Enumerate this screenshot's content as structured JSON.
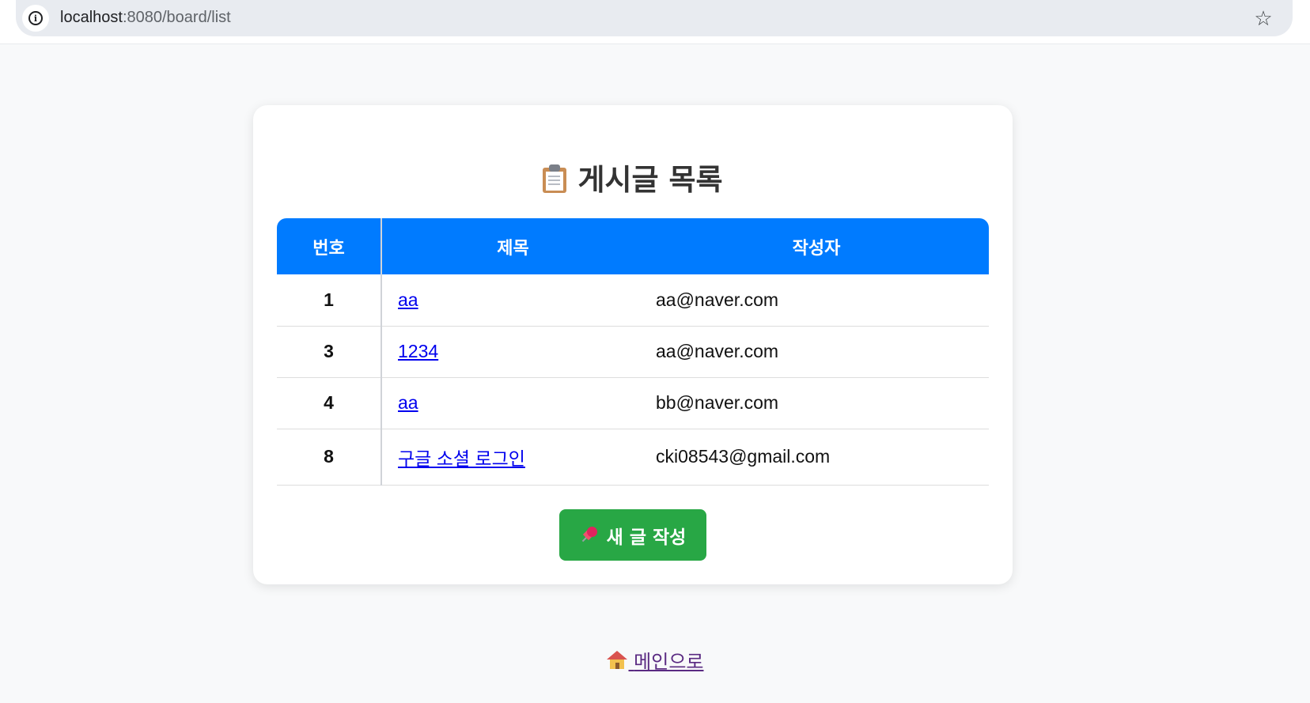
{
  "browser": {
    "url_host": "localhost",
    "url_path": ":8080/board/list"
  },
  "page": {
    "title": "게시글 목록",
    "title_icon": "clipboard-icon"
  },
  "table": {
    "headers": {
      "no": "번호",
      "title": "제목",
      "author": "작성자"
    },
    "rows": [
      {
        "no": "1",
        "title": "aa",
        "author": "aa@naver.com"
      },
      {
        "no": "3",
        "title": "1234",
        "author": "aa@naver.com"
      },
      {
        "no": "4",
        "title": "aa",
        "author": "bb@naver.com"
      },
      {
        "no": "8",
        "title": "구글 소셜 로그인",
        "author": "cki08543@gmail.com"
      }
    ]
  },
  "actions": {
    "write_label": "새 글 작성",
    "write_icon": "pushpin-icon",
    "home_label": "메인으로",
    "home_icon": "house-icon"
  },
  "colors": {
    "header_bg": "#007bff",
    "write_button_bg": "#28a745",
    "link": "#0000ee",
    "visited_link": "#5a2a82"
  }
}
